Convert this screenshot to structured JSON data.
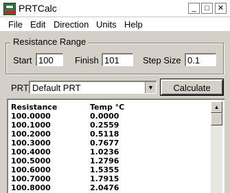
{
  "window": {
    "title": "PRTCalc",
    "minimize": "_",
    "maximize": "□",
    "close": "✕"
  },
  "menu": [
    "File",
    "Edit",
    "Direction",
    "Units",
    "Help"
  ],
  "range": {
    "group_label": "Resistance Range",
    "start_label": "Start",
    "start_value": "100",
    "finish_label": "Finish",
    "finish_value": "101",
    "step_label": "Step Size",
    "step_value": "0.1"
  },
  "prt": {
    "label": "PRT",
    "selected": "Default PRT",
    "calculate_label": "Calculate"
  },
  "results": {
    "headers": [
      "Resistance",
      "Temp °C"
    ],
    "rows": [
      [
        "100.0000",
        "0.0000"
      ],
      [
        "100.1000",
        "0.2559"
      ],
      [
        "100.2000",
        "0.5118"
      ],
      [
        "100.3000",
        "0.7677"
      ],
      [
        "100.4000",
        "1.0236"
      ],
      [
        "100.5000",
        "1.2796"
      ],
      [
        "100.6000",
        "1.5355"
      ],
      [
        "100.7000",
        "1.7915"
      ],
      [
        "100.8000",
        "2.0476"
      ]
    ]
  },
  "icons": {
    "app": "prtcalc-app-icon",
    "dropdown": "chevron-down-icon",
    "scroll_up": "scroll-up-arrow-icon"
  }
}
